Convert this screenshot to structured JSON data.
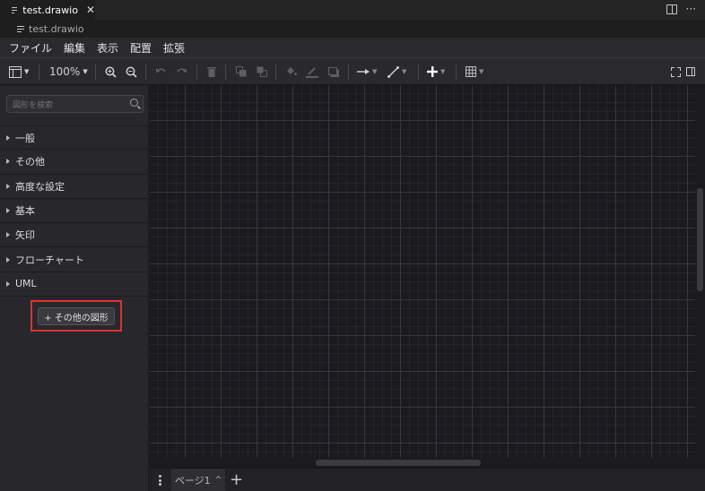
{
  "editor_tab": {
    "title": "test.drawio",
    "close": "✕"
  },
  "breadcrumb": {
    "file": "test.drawio"
  },
  "menubar": [
    "ファイル",
    "編集",
    "表示",
    "配置",
    "拡張"
  ],
  "toolbar": {
    "zoom": "100%"
  },
  "sidebar": {
    "search_placeholder": "図形を検索",
    "categories": [
      "一般",
      "その他",
      "高度な設定",
      "基本",
      "矢印",
      "フローチャート",
      "UML"
    ],
    "more_shapes": "+ その他の図形"
  },
  "pages": {
    "current": "ページ1",
    "caret": "^"
  },
  "colors": {
    "highlight": "#e03030",
    "canvas": "#1b1a1f"
  }
}
